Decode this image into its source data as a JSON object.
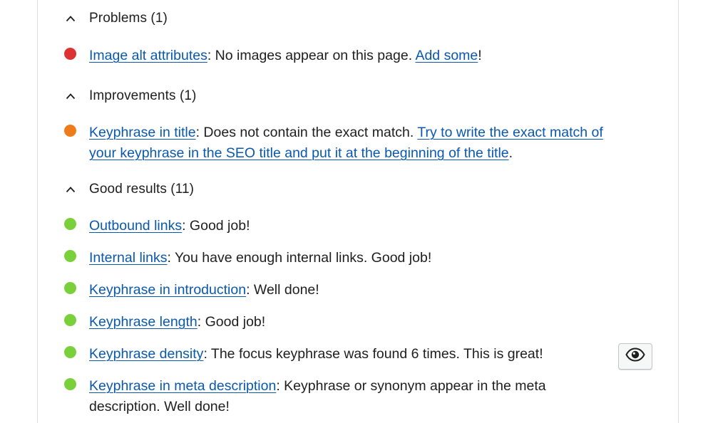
{
  "sections": {
    "problems": {
      "title": "Problems (1)"
    },
    "improvements": {
      "title": "Improvements (1)"
    },
    "good": {
      "title": "Good results (11)"
    }
  },
  "results": {
    "image_alt": {
      "link": "Image alt attributes",
      "text": ": No images appear on this page. ",
      "link2": "Add some",
      "tail": "!",
      "status": "problem"
    },
    "keyphrase_title": {
      "link": "Keyphrase in title",
      "text": ": Does not contain the exact match. ",
      "link2": "Try to write the exact match of your keyphrase in the SEO title and put it at the beginning of the title",
      "tail": ".",
      "status": "improvement"
    },
    "outbound": {
      "link": "Outbound links",
      "text": ": Good job!",
      "status": "good"
    },
    "internal": {
      "link": "Internal links",
      "text": ": You have enough internal links. Good job!",
      "status": "good"
    },
    "intro": {
      "link": "Keyphrase in introduction",
      "text": ": Well done!",
      "status": "good"
    },
    "length": {
      "link": "Keyphrase length",
      "text": ": Good job!",
      "status": "good"
    },
    "density": {
      "link": "Keyphrase density",
      "text": ": The focus keyphrase was found 6 times. This is great!",
      "status": "good"
    },
    "meta": {
      "link": "Keyphrase in meta description",
      "text": ": Keyphrase or synonym appear in the meta description. Well done!",
      "status": "good"
    }
  },
  "colors": {
    "problem": "#dc3232",
    "improvement": "#ee7c1b",
    "good": "#7ad03a",
    "link": "#0a58ad"
  },
  "icons": {
    "collapse": "chevron-up-icon",
    "highlight": "eye-icon"
  }
}
